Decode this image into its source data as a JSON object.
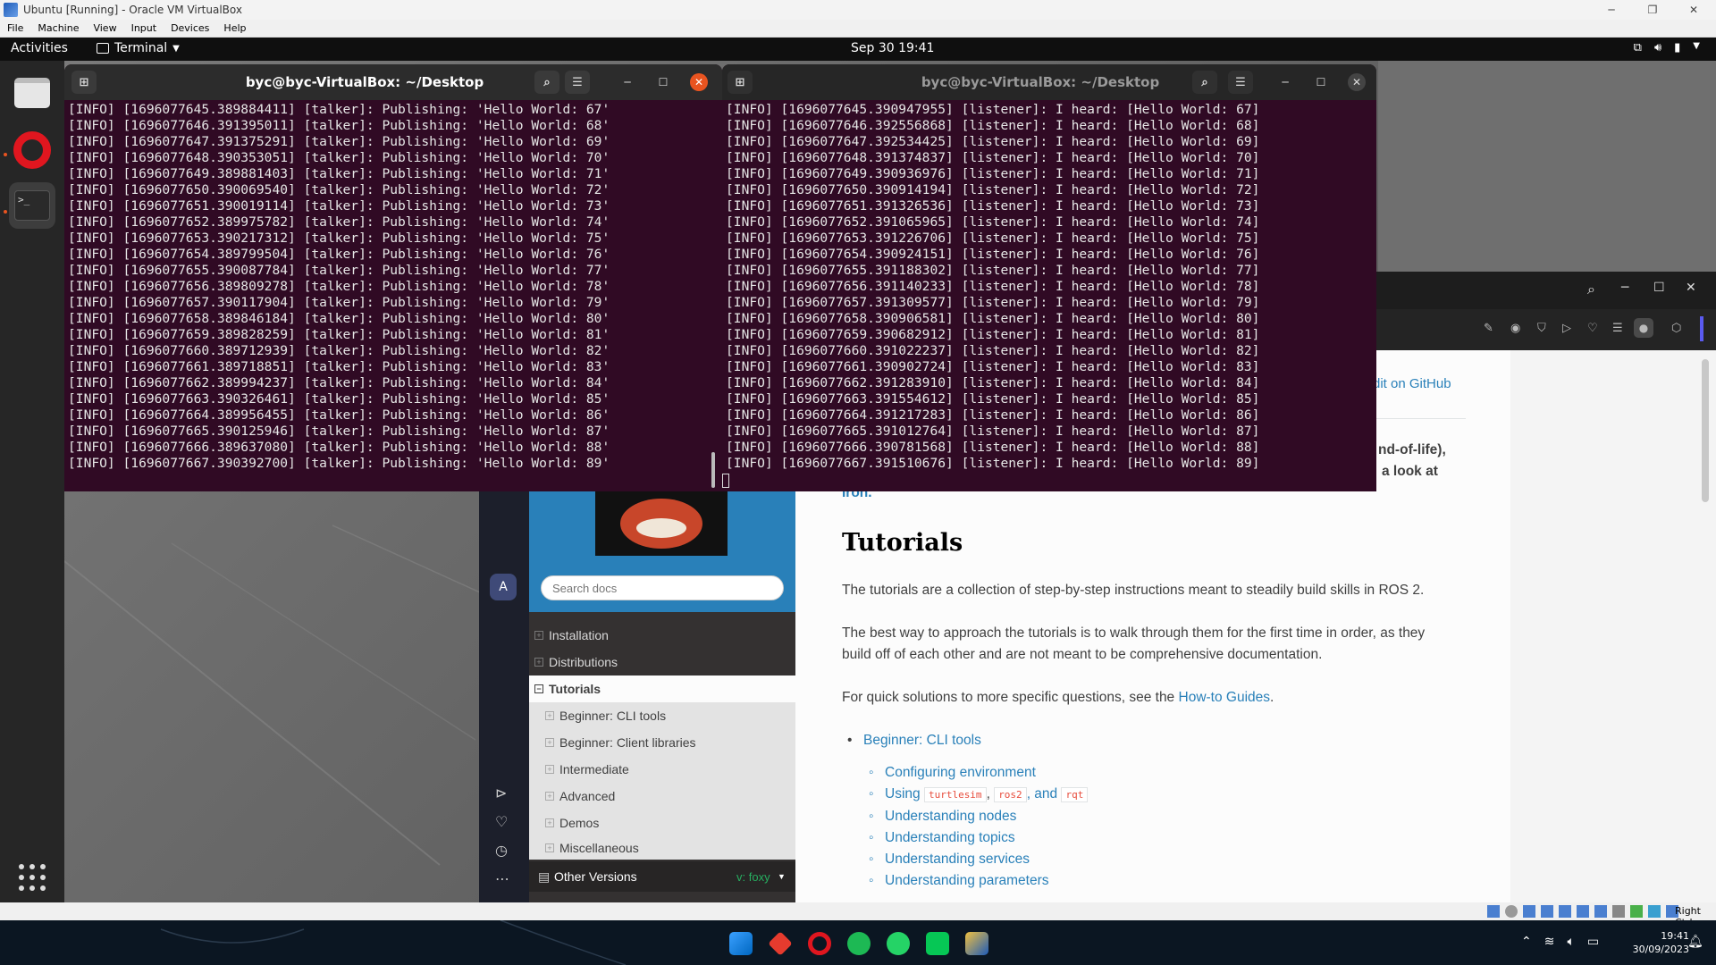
{
  "vbox": {
    "title": "Ubuntu [Running] - Oracle VM VirtualBox",
    "menu": [
      "File",
      "Machine",
      "View",
      "Input",
      "Devices",
      "Help"
    ],
    "status_right": "Right Ctrl"
  },
  "ubuntu_topbar": {
    "activities": "Activities",
    "app_menu": "Terminal",
    "clock": "Sep 30  19:41"
  },
  "terminal_left": {
    "title": "byc@byc-VirtualBox: ~/Desktop",
    "lines": [
      "[INFO] [1696077645.389884411] [talker]: Publishing: 'Hello World: 67'",
      "[INFO] [1696077646.391395011] [talker]: Publishing: 'Hello World: 68'",
      "[INFO] [1696077647.391375291] [talker]: Publishing: 'Hello World: 69'",
      "[INFO] [1696077648.390353051] [talker]: Publishing: 'Hello World: 70'",
      "[INFO] [1696077649.389881403] [talker]: Publishing: 'Hello World: 71'",
      "[INFO] [1696077650.390069540] [talker]: Publishing: 'Hello World: 72'",
      "[INFO] [1696077651.390019114] [talker]: Publishing: 'Hello World: 73'",
      "[INFO] [1696077652.389975782] [talker]: Publishing: 'Hello World: 74'",
      "[INFO] [1696077653.390217312] [talker]: Publishing: 'Hello World: 75'",
      "[INFO] [1696077654.389799504] [talker]: Publishing: 'Hello World: 76'",
      "[INFO] [1696077655.390087784] [talker]: Publishing: 'Hello World: 77'",
      "[INFO] [1696077656.389809278] [talker]: Publishing: 'Hello World: 78'",
      "[INFO] [1696077657.390117904] [talker]: Publishing: 'Hello World: 79'",
      "[INFO] [1696077658.389846184] [talker]: Publishing: 'Hello World: 80'",
      "[INFO] [1696077659.389828259] [talker]: Publishing: 'Hello World: 81'",
      "[INFO] [1696077660.389712939] [talker]: Publishing: 'Hello World: 82'",
      "[INFO] [1696077661.389718851] [talker]: Publishing: 'Hello World: 83'",
      "[INFO] [1696077662.389994237] [talker]: Publishing: 'Hello World: 84'",
      "[INFO] [1696077663.390326461] [talker]: Publishing: 'Hello World: 85'",
      "[INFO] [1696077664.389956455] [talker]: Publishing: 'Hello World: 86'",
      "[INFO] [1696077665.390125946] [talker]: Publishing: 'Hello World: 87'",
      "[INFO] [1696077666.389637080] [talker]: Publishing: 'Hello World: 88'",
      "[INFO] [1696077667.390392700] [talker]: Publishing: 'Hello World: 89'"
    ]
  },
  "terminal_right": {
    "title": "byc@byc-VirtualBox: ~/Desktop",
    "lines": [
      "[INFO] [1696077645.390947955] [listener]: I heard: [Hello World: 67]",
      "[INFO] [1696077646.392556868] [listener]: I heard: [Hello World: 68]",
      "[INFO] [1696077647.392534425] [listener]: I heard: [Hello World: 69]",
      "[INFO] [1696077648.391374837] [listener]: I heard: [Hello World: 70]",
      "[INFO] [1696077649.390936976] [listener]: I heard: [Hello World: 71]",
      "[INFO] [1696077650.390914194] [listener]: I heard: [Hello World: 72]",
      "[INFO] [1696077651.391326536] [listener]: I heard: [Hello World: 73]",
      "[INFO] [1696077652.391065965] [listener]: I heard: [Hello World: 74]",
      "[INFO] [1696077653.391226706] [listener]: I heard: [Hello World: 75]",
      "[INFO] [1696077654.390924151] [listener]: I heard: [Hello World: 76]",
      "[INFO] [1696077655.391188302] [listener]: I heard: [Hello World: 77]",
      "[INFO] [1696077656.391140233] [listener]: I heard: [Hello World: 78]",
      "[INFO] [1696077657.391309577] [listener]: I heard: [Hello World: 79]",
      "[INFO] [1696077658.390906581] [listener]: I heard: [Hello World: 80]",
      "[INFO] [1696077659.390682912] [listener]: I heard: [Hello World: 81]",
      "[INFO] [1696077660.391022237] [listener]: I heard: [Hello World: 82]",
      "[INFO] [1696077661.390902724] [listener]: I heard: [Hello World: 83]",
      "[INFO] [1696077662.391283910] [listener]: I heard: [Hello World: 84]",
      "[INFO] [1696077663.391554612] [listener]: I heard: [Hello World: 85]",
      "[INFO] [1696077664.391217283] [listener]: I heard: [Hello World: 86]",
      "[INFO] [1696077665.391012764] [listener]: I heard: [Hello World: 87]",
      "[INFO] [1696077666.390781568] [listener]: I heard: [Hello World: 88]",
      "[INFO] [1696077667.391510676] [listener]: I heard: [Hello World: 89]"
    ]
  },
  "docs": {
    "search_placeholder": "Search docs",
    "nav": {
      "installation": "Installation",
      "distributions": "Distributions",
      "tutorials": "Tutorials",
      "sub": [
        "Beginner: CLI tools",
        "Beginner: Client libraries",
        "Intermediate",
        "Advanced",
        "Demos",
        "Miscellaneous"
      ]
    },
    "other_versions": "Other Versions",
    "version": "v: foxy",
    "edit_link": "dit on GitHub",
    "frag1": "nd-of-life),",
    "frag2": "a look at",
    "frag3": "Iron.",
    "heading": "Tutorials",
    "p1": "The tutorials are a collection of step-by-step instructions meant to steadily build skills in ROS 2.",
    "p2a": "The best way to approach the tutorials is to walk through them for the first time in order, as they",
    "p2b": "build off of each other and are not meant to be comprehensive documentation.",
    "p3_pre": "For quick solutions to more specific questions, see the ",
    "p3_link": "How-to Guides",
    "p3_post": ".",
    "list_top": "Beginner: CLI tools",
    "list_sub": {
      "configuring": "Configuring environment",
      "using": "Using",
      "code1": "turtlesim",
      "code2": "ros2",
      "and": ", and",
      "code3": "rqt",
      "nodes": "Understanding nodes",
      "topics": "Understanding topics",
      "services": "Understanding services",
      "parameters": "Understanding parameters"
    }
  },
  "windows_taskbar": {
    "time": "19:41",
    "date": "30/09/2023"
  }
}
